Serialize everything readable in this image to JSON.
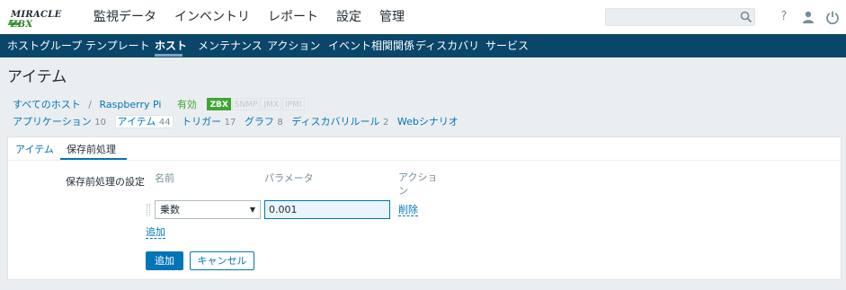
{
  "logo": {
    "text_main": "MIRACLE",
    "text_accent": "ZBX"
  },
  "top_menu": [
    "監視データ",
    "インベントリ",
    "レポート",
    "設定",
    "管理"
  ],
  "search": {
    "placeholder": ""
  },
  "top_icons": {
    "help": "?",
    "user": "user-icon",
    "power": "power-icon"
  },
  "nav": [
    "ホストグループ",
    "テンプレート",
    "ホスト",
    "メンテナンス",
    "アクション",
    "イベント相関関係",
    "ディスカバリ",
    "サービス"
  ],
  "page_title": "アイテム",
  "breadcrumb": {
    "all_hosts": "すべてのホスト",
    "separator": "/",
    "host": "Raspberry Pi",
    "status": "有効",
    "tags": [
      "ZBX",
      "SNMP",
      "JMX",
      "IPMI"
    ]
  },
  "host_tabs": [
    {
      "label": "アプリケーション",
      "count": "10"
    },
    {
      "label": "アイテム",
      "count": "44"
    },
    {
      "label": "トリガー",
      "count": "17"
    },
    {
      "label": "グラフ",
      "count": "8"
    },
    {
      "label": "ディスカバリルール",
      "count": "2"
    },
    {
      "label": "Webシナリオ",
      "count": ""
    }
  ],
  "form_tabs": [
    "アイテム",
    "保存前処理"
  ],
  "form": {
    "label": "保存前処理の設定",
    "col_name": "名前",
    "col_param": "パラメータ",
    "col_action_1": "アクショ",
    "col_action_2": "ン",
    "step_type": "乗数",
    "step_param": "0.001",
    "remove": "削除",
    "add_step": "追加",
    "submit": "追加",
    "cancel": "キャンセル"
  },
  "colors": {
    "nav_bg": "#0a466a",
    "link": "#0275b8",
    "enabled": "#3fa535"
  }
}
